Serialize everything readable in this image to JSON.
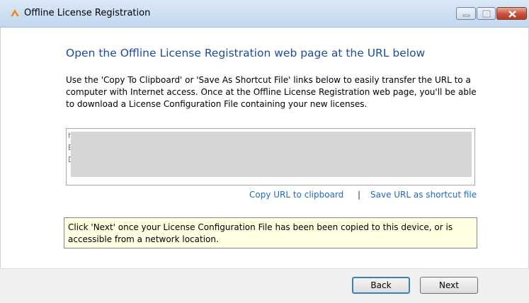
{
  "window": {
    "title": "Offline License Registration",
    "icon": "orange-arrow-icon",
    "controls": [
      "minimize-icon",
      "maximize-icon",
      "close-icon"
    ]
  },
  "main": {
    "heading": "Open the Offline License Registration web page at the URL below",
    "description": "Use the 'Copy To Clipboard' or 'Save As Shortcut File' links below to easily transfer the URL to a computer with Internet access. Once at the Offline License Registration web page, you'll be able to download a License Configuration File containing your new licenses.",
    "url_lines": [
      "h",
      "E",
      "D"
    ],
    "copy_link": "Copy URL to clipboard",
    "separator": "|",
    "save_link": "Save URL as shortcut file",
    "note": "Click 'Next' once your License Configuration File has been been copied to this device, or is accessible from a network location."
  },
  "buttons": {
    "back": "Back",
    "next": "Next"
  },
  "colors": {
    "heading": "#1e4b9c",
    "link": "#1e6bc6",
    "note_bg": "#ffffe1"
  }
}
